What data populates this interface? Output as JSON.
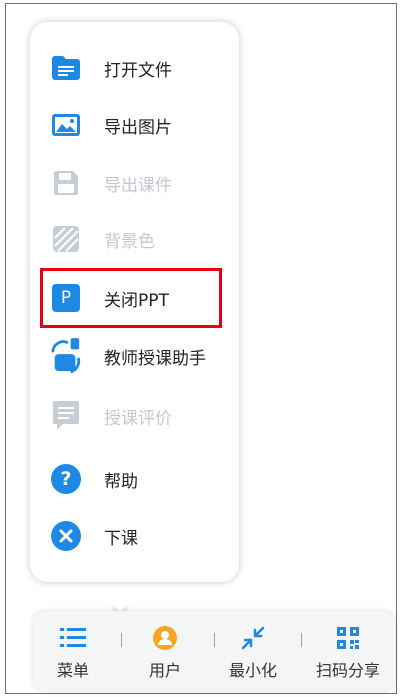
{
  "colors": {
    "accent": "#1e88e5",
    "disabled": "#c8ccd4",
    "highlight": "#e60012",
    "orange": "#f5a623"
  },
  "menu": {
    "items": [
      {
        "label": "打开文件",
        "icon": "folder-icon",
        "enabled": true
      },
      {
        "label": "导出图片",
        "icon": "image-icon",
        "enabled": true
      },
      {
        "label": "导出课件",
        "icon": "save-icon",
        "enabled": false
      },
      {
        "label": "背景色",
        "icon": "background-pattern-icon",
        "enabled": false
      },
      {
        "label": "关闭PPT",
        "icon": "ppt-icon",
        "enabled": true,
        "highlighted": true
      },
      {
        "label": "教师授课助手",
        "icon": "teaching-assistant-icon",
        "enabled": true
      },
      {
        "label": "授课评价",
        "icon": "comment-icon",
        "enabled": false
      },
      {
        "label": "帮助",
        "icon": "help-icon",
        "enabled": true
      },
      {
        "label": "下课",
        "icon": "close-circle-icon",
        "enabled": true
      }
    ]
  },
  "ppt_icon_letter": "P",
  "help_icon_glyph": "?",
  "toolbar": {
    "items": [
      {
        "label": "菜单",
        "icon": "menu-list-icon"
      },
      {
        "label": "用户",
        "icon": "user-icon"
      },
      {
        "label": "最小化",
        "icon": "minimize-icon"
      },
      {
        "label": "扫码分享",
        "icon": "qr-code-icon"
      }
    ]
  }
}
